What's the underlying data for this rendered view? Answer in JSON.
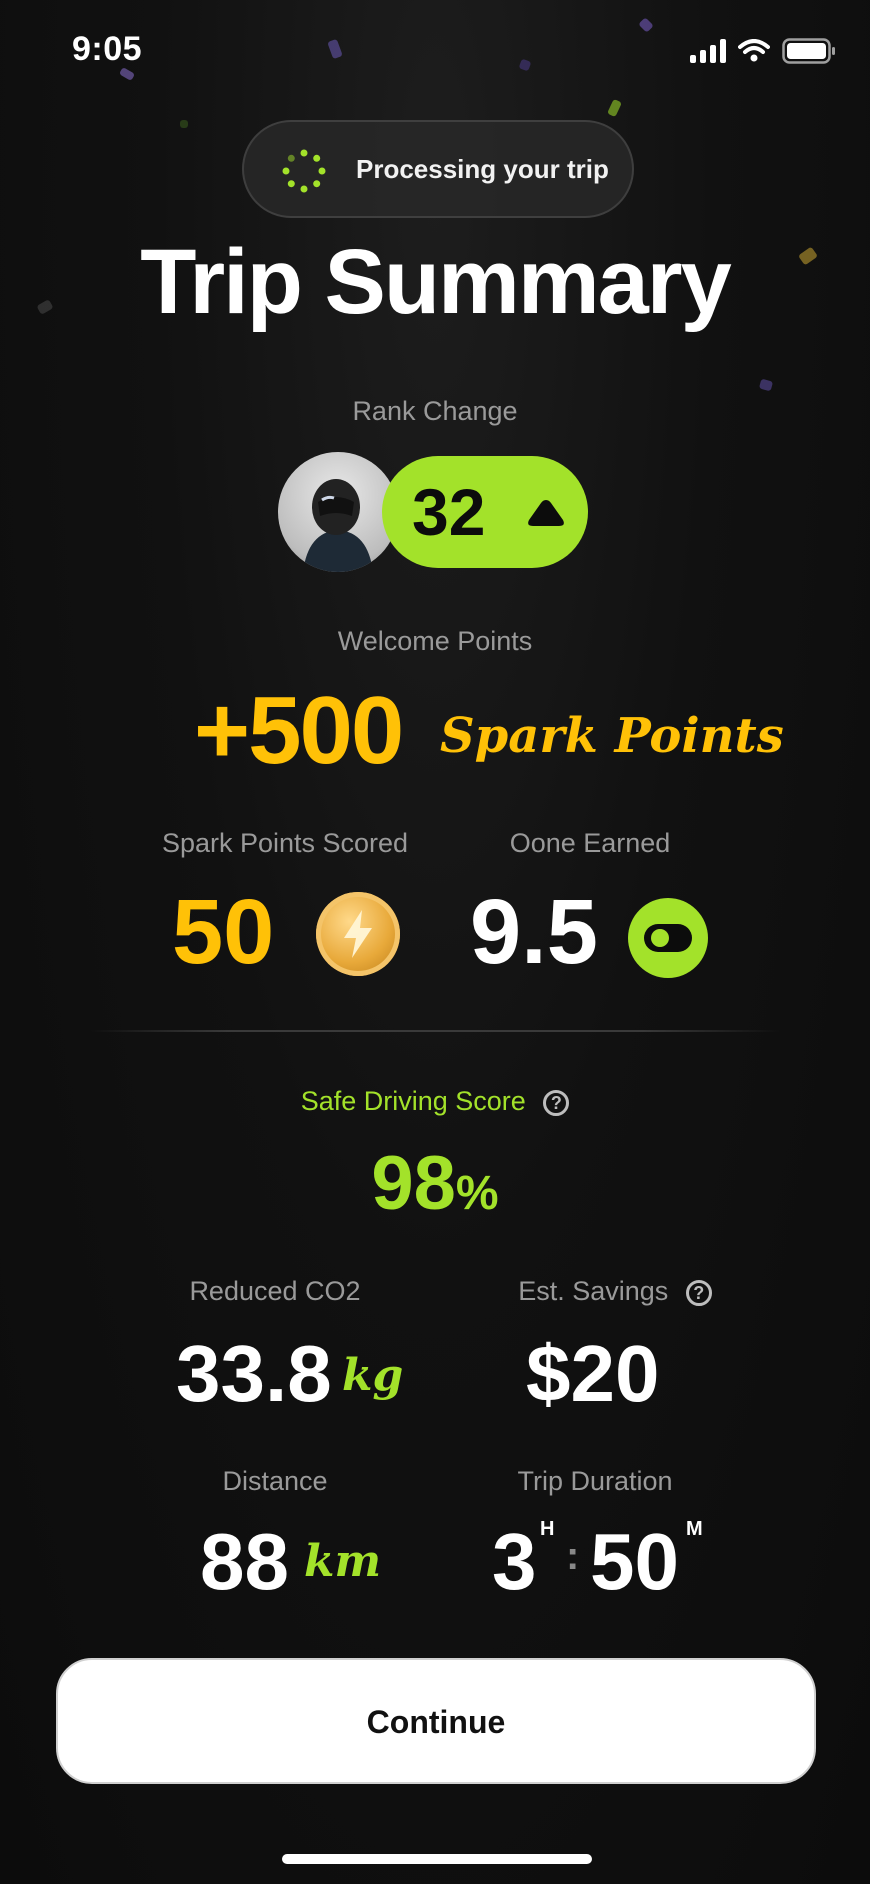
{
  "status_bar": {
    "time": "9:05"
  },
  "processing": {
    "text": "Processing your trip"
  },
  "title": "Trip Summary",
  "rank": {
    "label": "Rank Change",
    "value": "32"
  },
  "welcome": {
    "label": "Welcome Points",
    "value": "+500",
    "unit": "Spark Points"
  },
  "spark_scored": {
    "label": "Spark Points Scored",
    "value": "50"
  },
  "oone_earned": {
    "label": "Oone Earned",
    "value": "9.5"
  },
  "safe_driving": {
    "label": "Safe Driving Score",
    "value": "98",
    "unit": "%"
  },
  "co2": {
    "label": "Reduced CO2",
    "value": "33.8",
    "unit": "kg"
  },
  "savings": {
    "label": "Est. Savings",
    "value": "$20"
  },
  "distance": {
    "label": "Distance",
    "value": "88",
    "unit": "km"
  },
  "duration": {
    "label": "Trip Duration",
    "hours": "3",
    "hours_unit": "H",
    "separator": ":",
    "minutes": "50",
    "minutes_unit": "M"
  },
  "continue_label": "Continue",
  "colors": {
    "accent_green": "#a3e22a",
    "accent_yellow": "#ffc107",
    "background": "#0d0d0d"
  },
  "icons": [
    "signal-icon",
    "wifi-icon",
    "battery-icon",
    "spinner-icon",
    "rank-up-arrow-icon",
    "coin-icon",
    "oone-icon",
    "help-icon"
  ]
}
